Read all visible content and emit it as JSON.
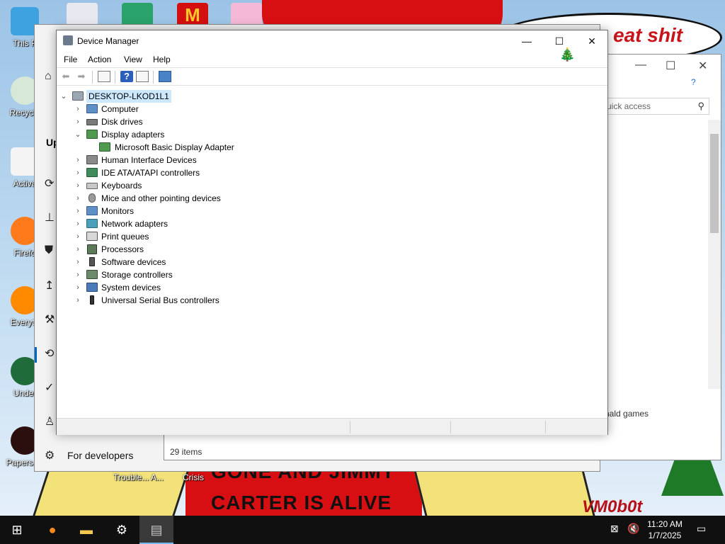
{
  "desktop": {
    "icons": [
      {
        "label": "This P"
      },
      {
        "label": "Recycle"
      },
      {
        "label": "Activa"
      },
      {
        "label": "Firefo"
      },
      {
        "label": "Everyth"
      },
      {
        "label": "Under"
      },
      {
        "label": "Papers, P"
      }
    ],
    "wallpaper_text_1": "GONE AND JIMMY",
    "wallpaper_text_2": "CARTER IS ALIVE",
    "bubble_text": "eat shit",
    "signature": "VM0b0t",
    "label_trouble": "Trouble... A...",
    "label_crisis": "Crisis"
  },
  "settings_window": {
    "heading": "Up",
    "for_developers": "For developers"
  },
  "explorer_window": {
    "search_placeholder": "uick access",
    "item_text": "nald games",
    "status": "29 items"
  },
  "device_manager": {
    "title": "Device Manager",
    "menu": [
      "File",
      "Action",
      "View",
      "Help"
    ],
    "root": "DESKTOP-LKOD1L1",
    "tree": [
      {
        "label": "Computer",
        "expanded": false
      },
      {
        "label": "Disk drives",
        "expanded": false
      },
      {
        "label": "Display adapters",
        "expanded": true
      },
      {
        "label": "Microsoft Basic Display Adapter",
        "child": true
      },
      {
        "label": "Human Interface Devices",
        "expanded": false
      },
      {
        "label": "IDE ATA/ATAPI controllers",
        "expanded": false
      },
      {
        "label": "Keyboards",
        "expanded": false
      },
      {
        "label": "Mice and other pointing devices",
        "expanded": false
      },
      {
        "label": "Monitors",
        "expanded": false
      },
      {
        "label": "Network adapters",
        "expanded": false
      },
      {
        "label": "Print queues",
        "expanded": false
      },
      {
        "label": "Processors",
        "expanded": false
      },
      {
        "label": "Software devices",
        "expanded": false
      },
      {
        "label": "Storage controllers",
        "expanded": false
      },
      {
        "label": "System devices",
        "expanded": false
      },
      {
        "label": "Universal Serial Bus controllers",
        "expanded": false
      }
    ]
  },
  "taskbar": {
    "time": "11:20 AM",
    "date": "1/7/2025"
  },
  "colors": {
    "accent": "#0067c0",
    "selection": "#cce8ff",
    "taskbar": "#101010",
    "wallpaper_red": "#d80f12"
  }
}
